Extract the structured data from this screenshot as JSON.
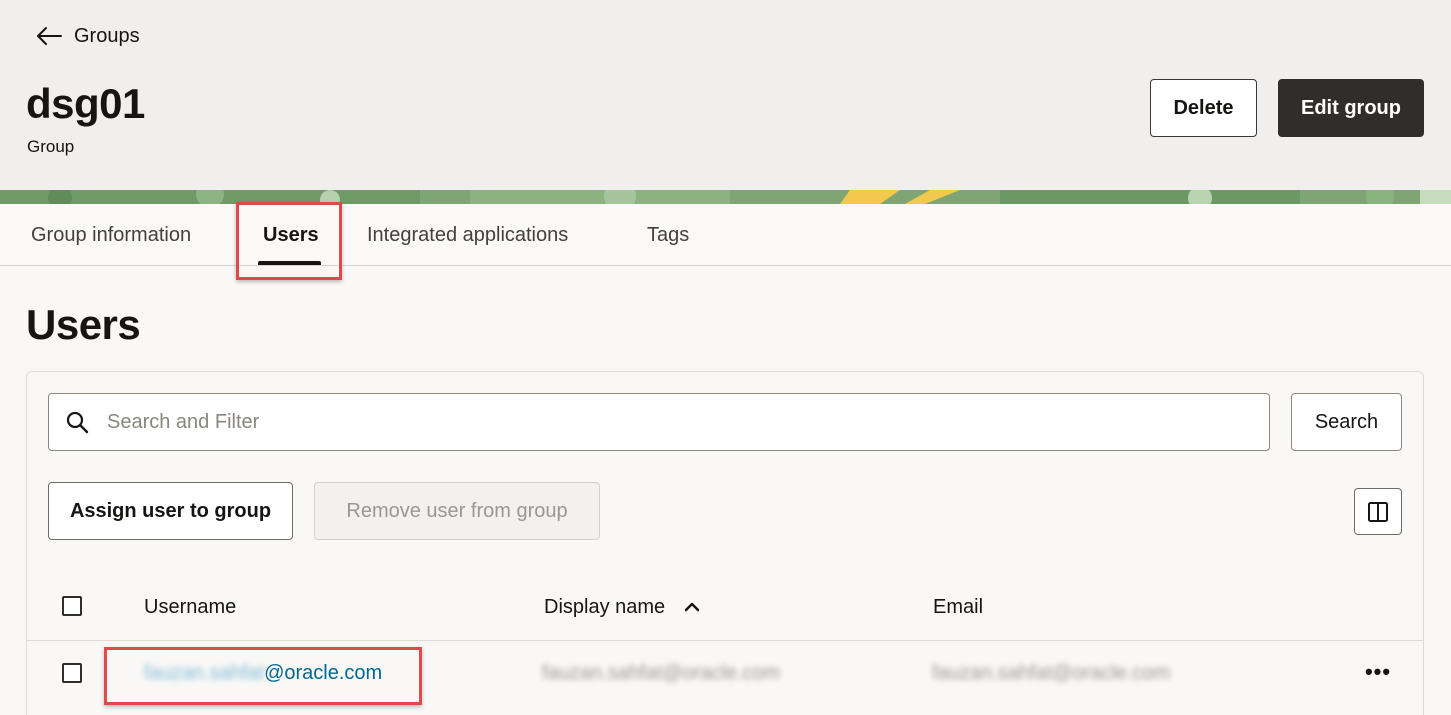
{
  "header": {
    "back_label": "Groups",
    "title": "dsg01",
    "subtitle": "Group",
    "delete_label": "Delete",
    "edit_label": "Edit group"
  },
  "tabs": [
    {
      "label": "Group information",
      "active": false
    },
    {
      "label": "Users",
      "active": true
    },
    {
      "label": "Integrated applications",
      "active": false
    },
    {
      "label": "Tags",
      "active": false
    }
  ],
  "section": {
    "title": "Users"
  },
  "search": {
    "placeholder": "Search and Filter",
    "value": "",
    "button_label": "Search"
  },
  "actions": {
    "assign_label": "Assign user to group",
    "remove_label": "Remove user from group"
  },
  "table": {
    "columns": [
      "Username",
      "Display name",
      "Email"
    ],
    "sorted_column": "Display name",
    "sort_direction": "ascending",
    "rows": [
      {
        "username_redacted": "fauzan.sahfat",
        "username_domain": "@oracle.com",
        "display_name": "fauzan.sahfat@oracle.com",
        "email": "fauzan.sahfat@oracle.com"
      }
    ]
  },
  "colors": {
    "primary_dark": "#312d2a",
    "link": "#00688c",
    "highlight": "#e0484a",
    "header_bg": "#f1efed"
  },
  "icons": [
    "arrow-left-icon",
    "search-icon",
    "manage-columns-icon",
    "sort-ascending-icon",
    "more-actions-icon"
  ]
}
